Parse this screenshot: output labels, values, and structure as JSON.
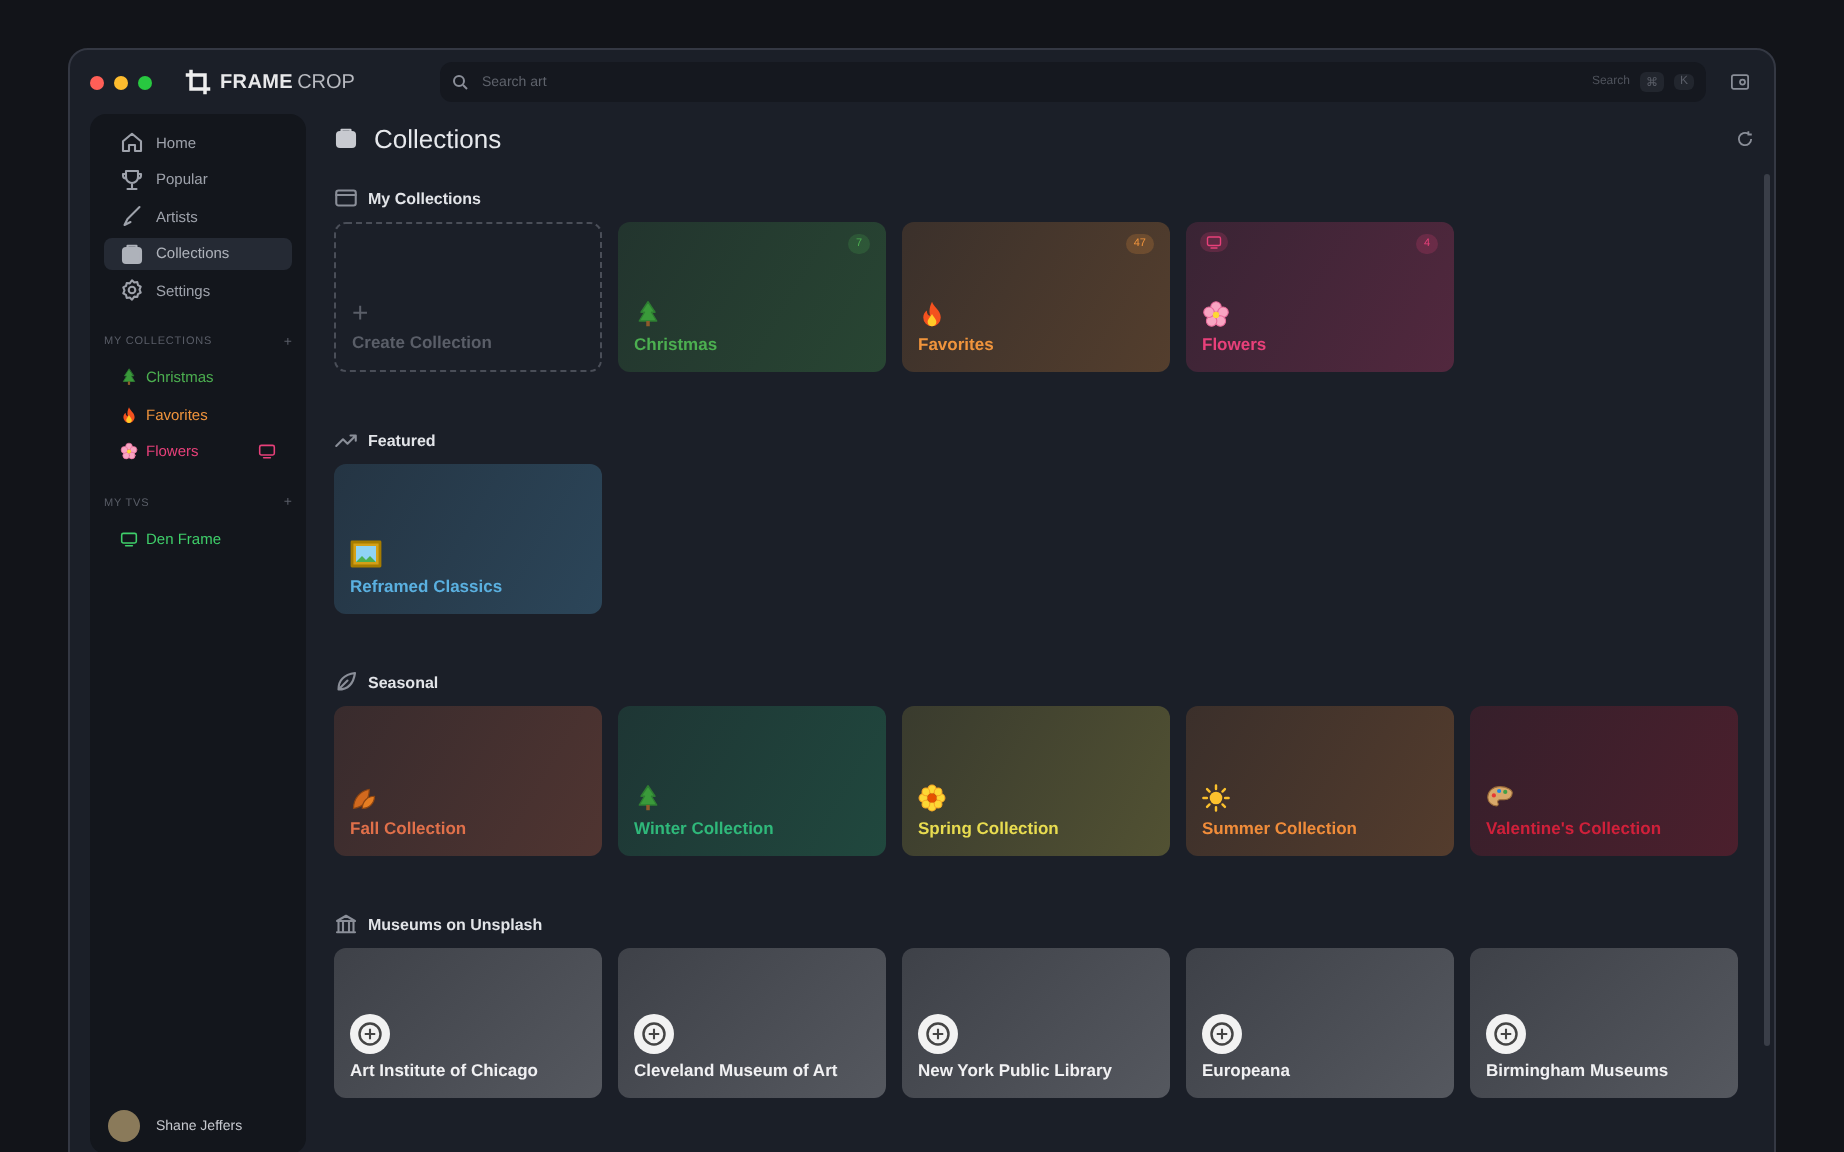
{
  "brand": {
    "word_1": "FRAME",
    "word_2": "CROP"
  },
  "search": {
    "placeholder": "Search art",
    "hint": "Search",
    "keys": [
      "⌘",
      "K"
    ]
  },
  "sidebar": {
    "nav": [
      {
        "label": "Home",
        "kind": "home",
        "selected": false
      },
      {
        "label": "Popular",
        "kind": "trophy",
        "selected": false
      },
      {
        "label": "Artists",
        "kind": "brush",
        "selected": false
      },
      {
        "label": "Collections",
        "kind": "folder",
        "selected": true
      },
      {
        "label": "Settings",
        "kind": "gear",
        "selected": false
      }
    ],
    "collections_heading": "MY COLLECTIONS",
    "collections_add": "+",
    "collections": [
      {
        "label": "Christmas",
        "kind": "tree",
        "color": "#4caf50",
        "on_tv": false
      },
      {
        "label": "Favorites",
        "kind": "flame",
        "color": "#f0943c",
        "on_tv": false
      },
      {
        "label": "Flowers",
        "kind": "blossom",
        "color": "#e8407a",
        "on_tv": true
      }
    ],
    "tvs_heading": "MY TVS",
    "tvs_add": "+",
    "tvs": [
      {
        "label": "Den Frame",
        "color": "#3fcf6a"
      }
    ],
    "user": {
      "name": "Shane Jeffers"
    }
  },
  "page": {
    "title": "Collections"
  },
  "sections": [
    {
      "title": "My Collections",
      "kind": "window",
      "create_symbol": "+",
      "create_label": "Create Collection",
      "cards": [
        {
          "label": "Christmas",
          "kind": "tree",
          "color": "#4caf50",
          "count": "7",
          "on_tv": false
        },
        {
          "label": "Favorites",
          "kind": "flame",
          "color": "#f0943c",
          "count": "47",
          "on_tv": false
        },
        {
          "label": "Flowers",
          "kind": "blossom",
          "color": "#e8407a",
          "count": "4",
          "on_tv": true
        }
      ]
    },
    {
      "title": "Featured",
      "kind": "trend",
      "cards": [
        {
          "label": "Reframed Classics",
          "kind": "picture",
          "color": "#5ab0e0"
        }
      ]
    },
    {
      "title": "Seasonal",
      "kind": "leaf",
      "cards": [
        {
          "label": "Fall Collection",
          "kind": "leaves",
          "color": "#e0704a"
        },
        {
          "label": "Winter Collection",
          "kind": "tree",
          "color": "#2fb87a"
        },
        {
          "label": "Spring Collection",
          "kind": "flower",
          "color": "#e8dc50"
        },
        {
          "label": "Summer Collection",
          "kind": "sun",
          "color": "#f08c3a"
        },
        {
          "label": "Valentine's Collection",
          "kind": "palette",
          "color": "#d0203a"
        }
      ]
    },
    {
      "title": "Museums on Unsplash",
      "kind": "museum",
      "cards": [
        {
          "label": "Art Institute of Chicago",
          "kind": "logo"
        },
        {
          "label": "Cleveland Museum of Art",
          "kind": "logo"
        },
        {
          "label": "New York Public Library",
          "kind": "logo"
        },
        {
          "label": "Europeana",
          "kind": "logo"
        },
        {
          "label": "Birmingham Museums",
          "kind": "logo"
        }
      ]
    }
  ]
}
